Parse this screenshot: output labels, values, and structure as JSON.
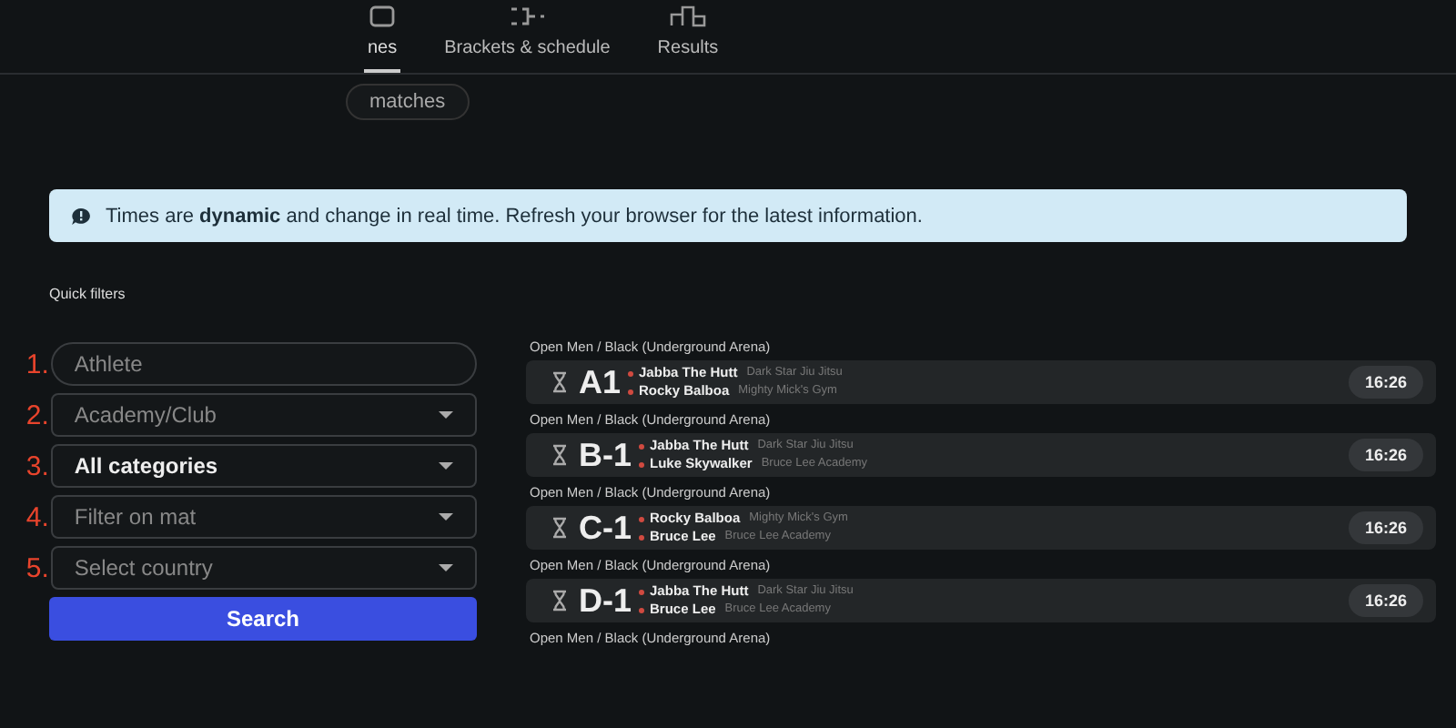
{
  "tabs": [
    {
      "label": "nes",
      "selected": true
    },
    {
      "label": "Brackets & schedule",
      "selected": false
    },
    {
      "label": "Results",
      "selected": false
    }
  ],
  "subfilter": {
    "label": "matches"
  },
  "notice": {
    "text": "Times are **dynamic** and change in real time. Refresh your browser for the latest information."
  },
  "quick_filters": {
    "title": "Quick filters",
    "fields": [
      {
        "number": "1.",
        "kind": "text",
        "placeholder": "Athlete"
      },
      {
        "number": "2.",
        "kind": "select",
        "placeholder": "Academy/Club"
      },
      {
        "number": "3.",
        "kind": "select",
        "value": "All categories"
      },
      {
        "number": "4.",
        "kind": "select",
        "placeholder": "Filter on mat"
      },
      {
        "number": "5.",
        "kind": "select",
        "placeholder": "Select country"
      }
    ],
    "button": "Search"
  },
  "matches": [
    {
      "category": "Open Men / Black (Underground Arena)",
      "fight": "A1",
      "time": "16:26",
      "athletes": [
        {
          "name": "Jabba The Hutt",
          "club": "Dark Star Jiu Jitsu"
        },
        {
          "name": "Rocky Balboa",
          "club": "Mighty Mick's Gym"
        }
      ]
    },
    {
      "category": "Open Men / Black (Underground Arena)",
      "fight": "B-1",
      "time": "16:26",
      "athletes": [
        {
          "name": "Jabba The Hutt",
          "club": "Dark Star Jiu Jitsu"
        },
        {
          "name": "Luke Skywalker",
          "club": "Bruce Lee Academy"
        }
      ]
    },
    {
      "category": "Open Men / Black (Underground Arena)",
      "fight": "C-1",
      "time": "16:26",
      "athletes": [
        {
          "name": "Rocky Balboa",
          "club": "Mighty Mick's Gym"
        },
        {
          "name": "Bruce Lee",
          "club": "Bruce Lee Academy"
        }
      ]
    },
    {
      "category": "Open Men / Black (Underground Arena)",
      "fight": "D-1",
      "time": "16:26",
      "athletes": [
        {
          "name": "Jabba The Hutt",
          "club": "Dark Star Jiu Jitsu"
        },
        {
          "name": "Bruce Lee",
          "club": "Bruce Lee Academy"
        }
      ]
    },
    {
      "category": "Open Men / Black (Underground Arena)"
    }
  ]
}
